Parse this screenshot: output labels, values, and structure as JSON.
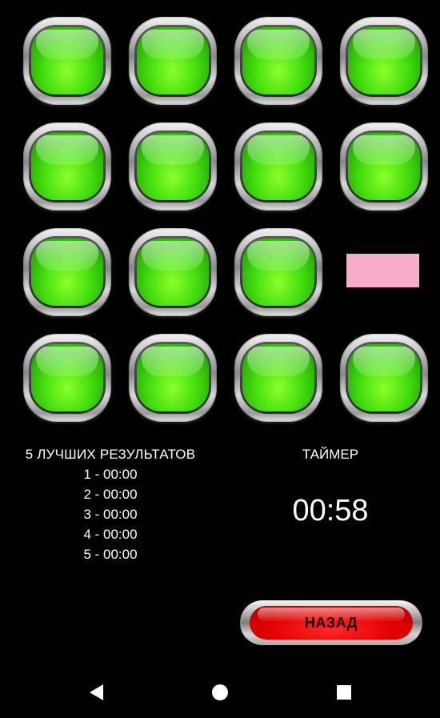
{
  "board": {
    "rows": 4,
    "cols": 4,
    "tiles": [
      {
        "row": 0,
        "col": 0,
        "state": "green"
      },
      {
        "row": 0,
        "col": 1,
        "state": "green"
      },
      {
        "row": 0,
        "col": 2,
        "state": "green"
      },
      {
        "row": 0,
        "col": 3,
        "state": "green"
      },
      {
        "row": 1,
        "col": 0,
        "state": "green"
      },
      {
        "row": 1,
        "col": 1,
        "state": "green"
      },
      {
        "row": 1,
        "col": 2,
        "state": "green"
      },
      {
        "row": 1,
        "col": 3,
        "state": "green"
      },
      {
        "row": 2,
        "col": 0,
        "state": "green"
      },
      {
        "row": 2,
        "col": 1,
        "state": "green"
      },
      {
        "row": 2,
        "col": 2,
        "state": "green"
      },
      {
        "row": 2,
        "col": 3,
        "state": "empty"
      },
      {
        "row": 3,
        "col": 0,
        "state": "green"
      },
      {
        "row": 3,
        "col": 1,
        "state": "green"
      },
      {
        "row": 3,
        "col": 2,
        "state": "green"
      },
      {
        "row": 3,
        "col": 3,
        "state": "green"
      }
    ],
    "empty_slot_color": "#f7adc8",
    "tile_color": "#46e010"
  },
  "results": {
    "title": "5 ЛУЧШИХ РЕЗУЛЬТАТОВ",
    "items": [
      "1 - 00:00",
      "2 - 00:00",
      "3 - 00:00",
      "4 - 00:00",
      "5 - 00:00"
    ]
  },
  "timer": {
    "title": "ТАЙМЕР",
    "value": "00:58"
  },
  "back_button": {
    "label": "НАЗАД",
    "color": "#e30000"
  },
  "nav_bar": {
    "back_icon": "triangle-back-icon",
    "home_icon": "circle-home-icon",
    "recents_icon": "square-recents-icon"
  }
}
